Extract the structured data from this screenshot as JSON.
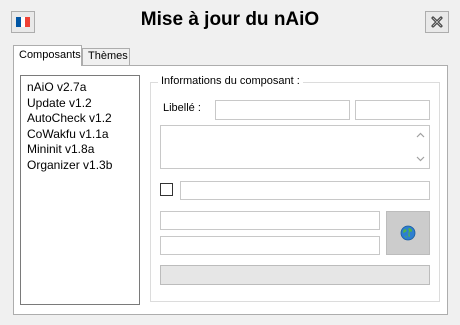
{
  "window": {
    "title": "Mise à jour du nAiO"
  },
  "header": {
    "language_icon": "france-flag-icon",
    "close_icon": "close-x-icon"
  },
  "tabs": [
    {
      "label": "Composants",
      "active": true
    },
    {
      "label": "Thèmes",
      "active": false
    }
  ],
  "components": [
    "nAiO v2.7a",
    "Update v1.2",
    "AutoCheck v1.2",
    "CoWakfu v1.1a",
    "Mininit v1.8a",
    "Organizer v1.3b"
  ],
  "details": {
    "group_label": "Informations du composant :",
    "libelle_label": "Libellé :",
    "libelle_value": "",
    "version_value": "",
    "description_value": "",
    "checkbox_checked": false,
    "checkbox_text_value": "",
    "path_value_1": "",
    "path_value_2": "",
    "globe_icon": "globe-icon",
    "progress_fraction": 0
  },
  "colors": {
    "window_bg": "#f0f0f0",
    "panel_bg": "#ffffff",
    "progress_bg": "#e6e6e6",
    "flag_blue": "#0055a4",
    "flag_white": "#ffffff",
    "flag_red": "#ef4135"
  }
}
